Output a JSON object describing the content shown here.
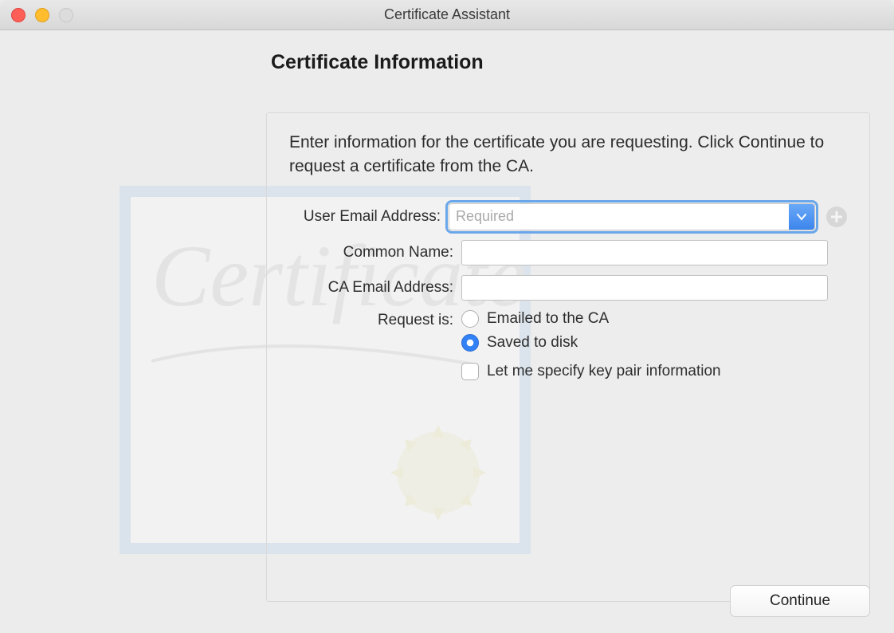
{
  "window": {
    "title": "Certificate Assistant"
  },
  "heading": "Certificate Information",
  "instructions": "Enter information for the certificate you are requesting. Click Continue to request a certificate from the CA.",
  "form": {
    "user_email": {
      "label": "User Email Address:",
      "placeholder": "Required",
      "value": ""
    },
    "common_name": {
      "label": "Common Name:",
      "value": ""
    },
    "ca_email": {
      "label": "CA Email Address:",
      "value": ""
    },
    "request_is": {
      "label": "Request is:",
      "options": {
        "emailed": {
          "label": "Emailed to the CA",
          "selected": false
        },
        "saved": {
          "label": "Saved to disk",
          "selected": true
        }
      }
    },
    "keypair_checkbox": {
      "label": "Let me specify key pair information",
      "checked": false
    }
  },
  "buttons": {
    "continue": "Continue"
  }
}
